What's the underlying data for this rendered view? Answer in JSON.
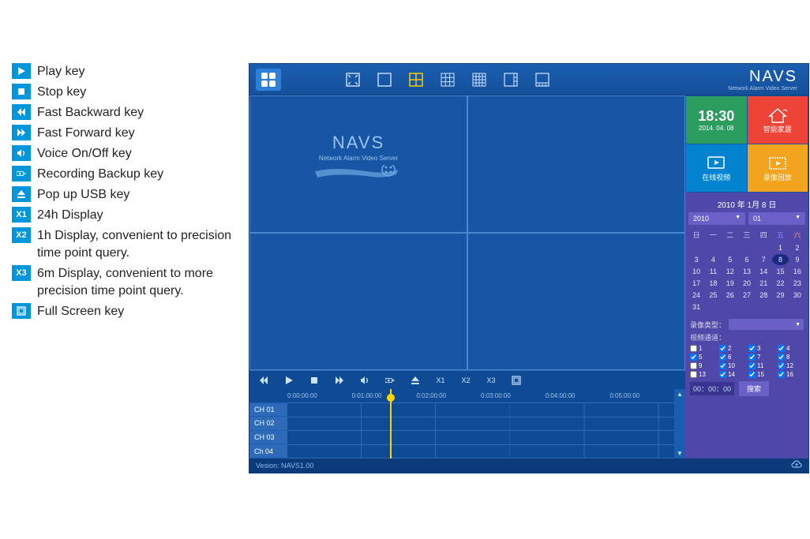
{
  "legend": [
    {
      "icon": "play",
      "text": "Play key"
    },
    {
      "icon": "stop",
      "text": "Stop key"
    },
    {
      "icon": "fb",
      "text": "Fast Backward key"
    },
    {
      "icon": "ff",
      "text": "Fast Forward key"
    },
    {
      "icon": "voice",
      "text": "Voice On/Off key"
    },
    {
      "icon": "rec",
      "text": "Recording Backup key"
    },
    {
      "icon": "usb",
      "text": "Pop up USB key"
    },
    {
      "icon": "x1",
      "text": "24h Display"
    },
    {
      "icon": "x2",
      "text": "1h Display, convenient to precision time point query."
    },
    {
      "icon": "x3",
      "text": "6m Display, convenient to more precision time point query."
    },
    {
      "icon": "fs",
      "text": "Full Screen key"
    }
  ],
  "brand": {
    "title": "NAVS",
    "sub": "Network Alarm Video Server"
  },
  "navs_logo": {
    "title": "NAVS",
    "sub": "Network Alarm Video Server"
  },
  "x_labels": {
    "x1": "X1",
    "x2": "X2",
    "x3": "X3"
  },
  "time_marks": [
    "0:00:00:00",
    "0:01:00:00",
    "0:02:00:00",
    "0:03:00:00",
    "0:04:00:00",
    "0:05:00:00"
  ],
  "channels": [
    "CH 01",
    "CH 02",
    "CH 03",
    "Ch 04"
  ],
  "tiles": {
    "time": {
      "t1": "18:30",
      "t2": "2014. 04. 08"
    },
    "home": "智能家居",
    "video": "在线视频",
    "playback": "录像回放"
  },
  "calendar": {
    "title": "2010 年 1月 8 日",
    "year": "2010",
    "month": "01",
    "heads": [
      "日",
      "一",
      "二",
      "三",
      "四",
      "五",
      "六"
    ],
    "days": [
      "",
      "",
      "",
      "",
      "",
      "1",
      "2",
      "3",
      "4",
      "5",
      "6",
      "7",
      "8",
      "9",
      "10",
      "11",
      "12",
      "13",
      "14",
      "15",
      "16",
      "17",
      "18",
      "19",
      "20",
      "21",
      "22",
      "23",
      "24",
      "25",
      "26",
      "27",
      "28",
      "29",
      "30",
      "31",
      "",
      "",
      "",
      "",
      "",
      ""
    ],
    "selected": "8"
  },
  "filters": {
    "type_label": "录像类型：",
    "channel_label": "视频通道：",
    "channels_checked": [
      false,
      true,
      true,
      true,
      true,
      true,
      true,
      true,
      false,
      true,
      true,
      true,
      false,
      true,
      true,
      true
    ],
    "timecode": "00：00：00",
    "search": "搜索"
  },
  "footer": {
    "version": "Vesion: NAVS1.00"
  }
}
